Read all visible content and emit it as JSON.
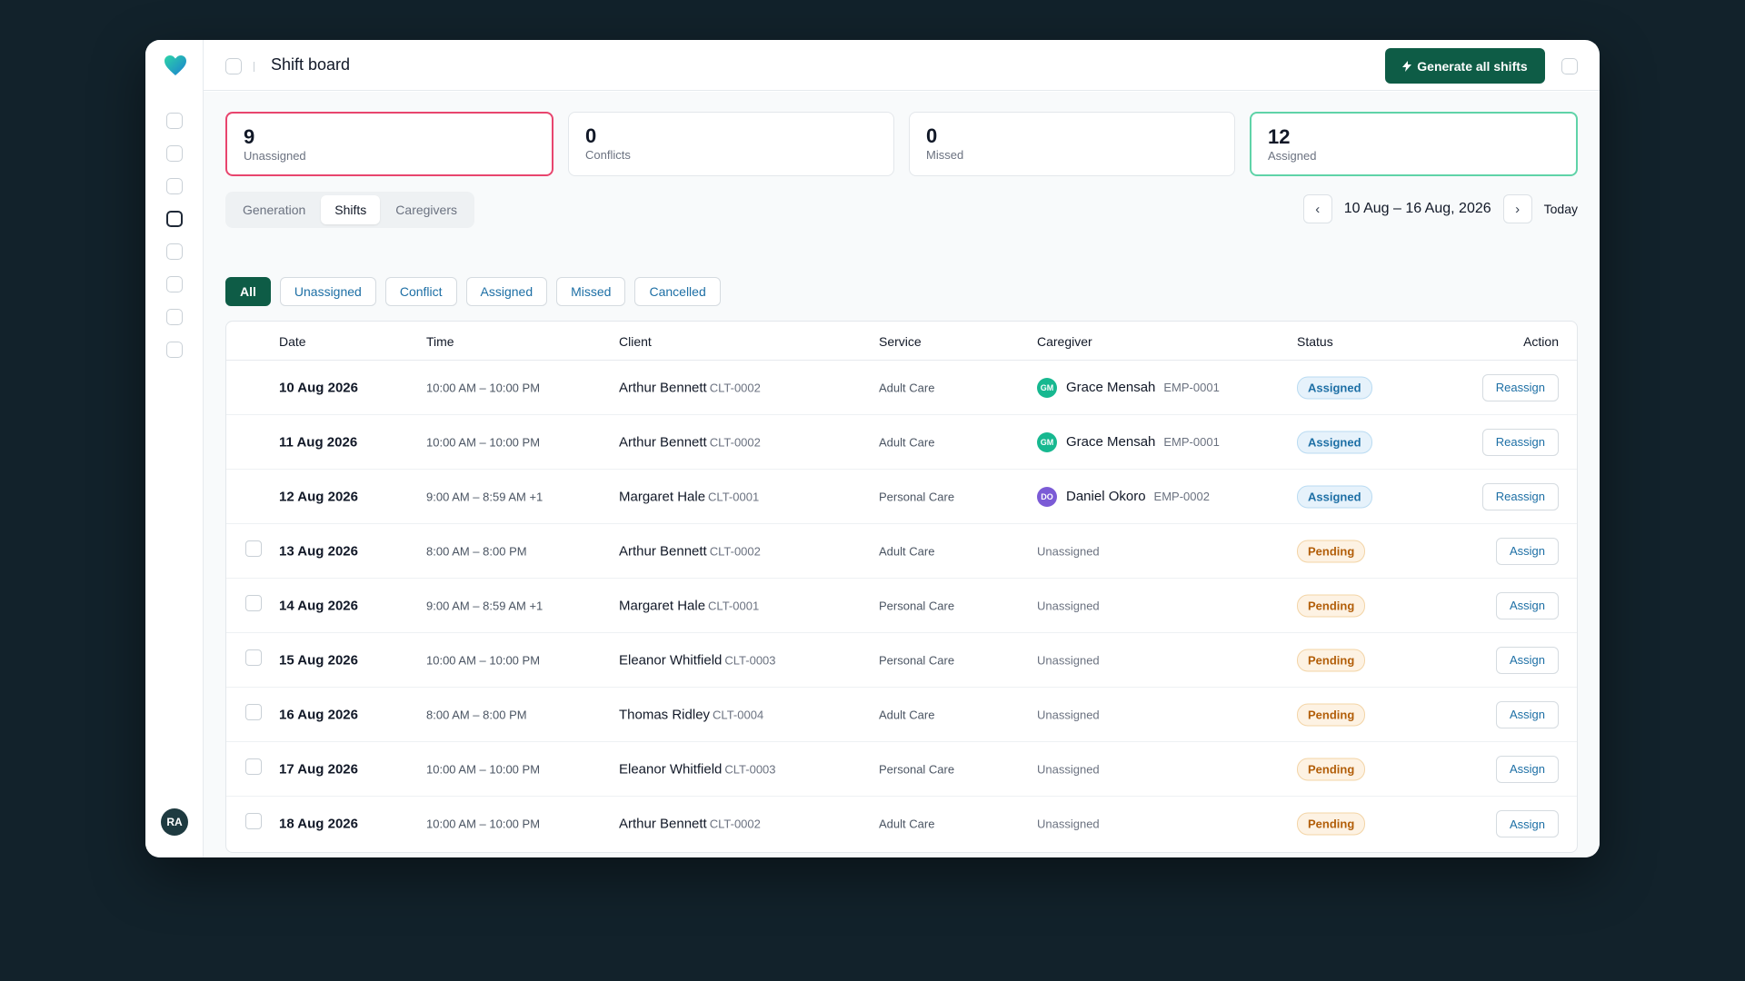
{
  "app": {
    "user_initials": "RA"
  },
  "header": {
    "title": "Shift board",
    "generate_label": "Generate all shifts"
  },
  "stats": [
    {
      "value": "9",
      "label": "Unassigned"
    },
    {
      "value": "0",
      "label": "Conflicts"
    },
    {
      "value": "0",
      "label": "Missed"
    },
    {
      "value": "12",
      "label": "Assigned"
    }
  ],
  "tabs": [
    "Generation",
    "Shifts",
    "Caregivers"
  ],
  "date_nav": {
    "prev": "‹",
    "range": "10 Aug – 16 Aug, 2026",
    "next": "›",
    "today": "Today"
  },
  "filters": [
    "All",
    "Unassigned",
    "Conflict",
    "Assigned",
    "Missed",
    "Cancelled"
  ],
  "table": {
    "columns": [
      "Date",
      "Time",
      "Client",
      "Service",
      "Caregiver",
      "Status",
      "Action"
    ],
    "rows": [
      {
        "date": "10 Aug 2026",
        "time": "10:00 AM – 10:00 PM",
        "client": "Arthur Bennett",
        "client_code": "CLT-0002",
        "service": "Adult Care",
        "caregiver": "Grace Mensah",
        "caregiver_initials": "GM",
        "caregiver_code": "EMP-0001",
        "status": "Assigned",
        "action": "Reassign"
      },
      {
        "date": "11 Aug 2026",
        "time": "10:00 AM – 10:00 PM",
        "client": "Arthur Bennett",
        "client_code": "CLT-0002",
        "service": "Adult Care",
        "caregiver": "Grace Mensah",
        "caregiver_initials": "GM",
        "caregiver_code": "EMP-0001",
        "status": "Assigned",
        "action": "Reassign"
      },
      {
        "date": "12 Aug 2026",
        "time": "9:00 AM – 8:59 AM +1",
        "client": "Margaret Hale",
        "client_code": "CLT-0001",
        "service": "Personal Care",
        "caregiver": "Daniel Okoro",
        "caregiver_initials": "DO",
        "caregiver_code": "EMP-0002",
        "status": "Assigned",
        "action": "Reassign"
      },
      {
        "date": "13 Aug 2026",
        "time": "8:00 AM – 8:00 PM",
        "client": "Arthur Bennett",
        "client_code": "CLT-0002",
        "service": "Adult Care",
        "caregiver": "Unassigned",
        "status": "Pending",
        "action": "Assign"
      },
      {
        "date": "14 Aug 2026",
        "time": "9:00 AM – 8:59 AM +1",
        "client": "Margaret Hale",
        "client_code": "CLT-0001",
        "service": "Personal Care",
        "caregiver": "Unassigned",
        "status": "Pending",
        "action": "Assign"
      },
      {
        "date": "15 Aug 2026",
        "time": "10:00 AM – 10:00 PM",
        "client": "Eleanor Whitfield",
        "client_code": "CLT-0003",
        "service": "Personal Care",
        "caregiver": "Unassigned",
        "status": "Pending",
        "action": "Assign"
      },
      {
        "date": "16 Aug 2026",
        "time": "8:00 AM – 8:00 PM",
        "client": "Thomas Ridley",
        "client_code": "CLT-0004",
        "service": "Adult Care",
        "caregiver": "Unassigned",
        "status": "Pending",
        "action": "Assign"
      },
      {
        "date": "17 Aug 2026",
        "time": "10:00 AM – 10:00 PM",
        "client": "Eleanor Whitfield",
        "client_code": "CLT-0003",
        "service": "Personal Care",
        "caregiver": "Unassigned",
        "status": "Pending",
        "action": "Assign"
      },
      {
        "date": "18 Aug 2026",
        "time": "10:00 AM – 10:00 PM",
        "client": "Arthur Bennett",
        "client_code": "CLT-0002",
        "service": "Adult Care",
        "caregiver": "Unassigned",
        "status": "Pending",
        "action": "Assign"
      }
    ]
  },
  "colors": {
    "background": "#12222b",
    "primary": "#0e5c46",
    "link": "#1d6fa5",
    "unassigned_border": "#e8456e",
    "assigned_border": "#5fd3a8",
    "avatar_gm": "#17b890",
    "avatar_do": "#7b5bd6"
  },
  "icons": {
    "logo": "heart-logo-icon",
    "generate": "lightning-icon",
    "prev": "chevron-left-icon",
    "next": "chevron-right-icon"
  }
}
